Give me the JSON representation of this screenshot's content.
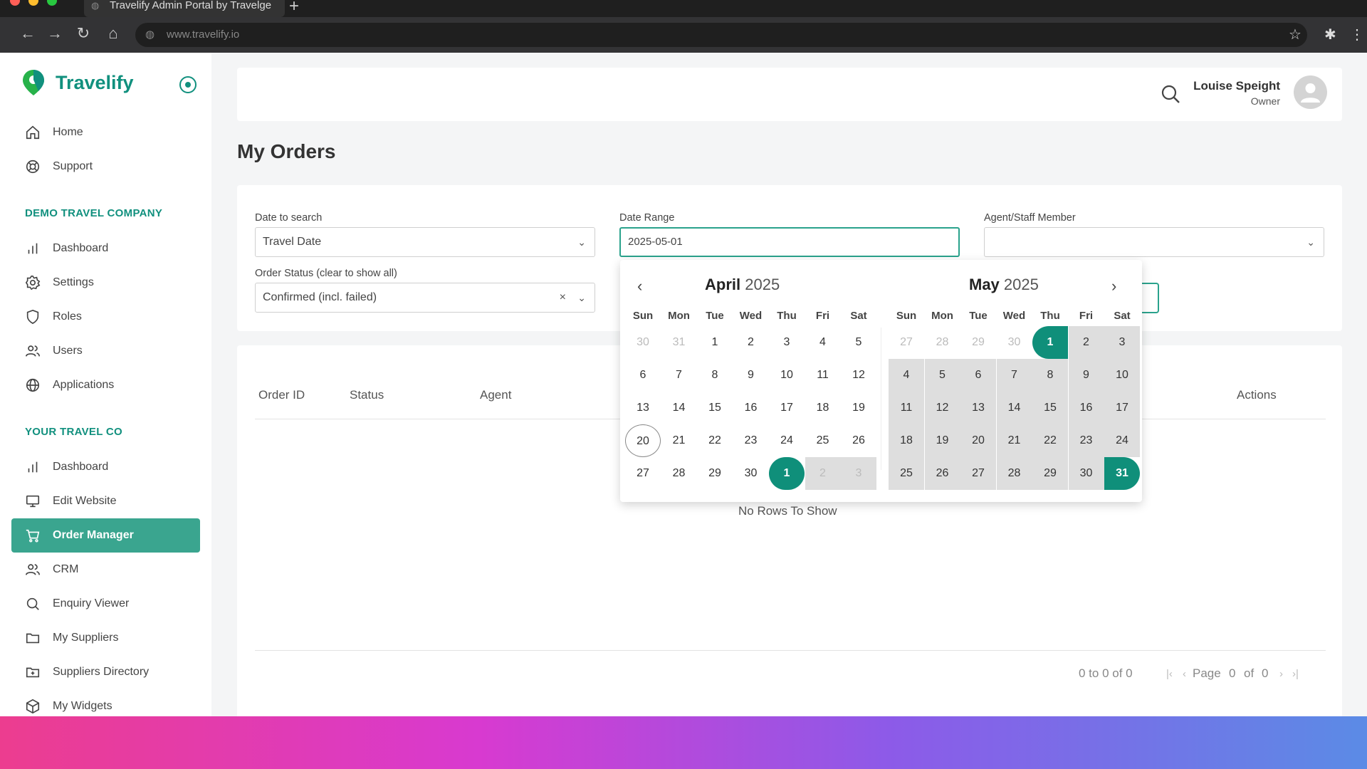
{
  "browser": {
    "tab_title": "Travelify Admin Portal by Travelge",
    "url": "www.travelify.io"
  },
  "sidebar": {
    "brand": "Travelify",
    "top_items": [
      {
        "label": "Home",
        "icon": "home-icon"
      },
      {
        "label": "Support",
        "icon": "lifebuoy-icon"
      }
    ],
    "sections": [
      {
        "title": "DEMO TRAVEL COMPANY",
        "items": [
          {
            "label": "Dashboard",
            "icon": "bar-chart-icon"
          },
          {
            "label": "Settings",
            "icon": "gear-icon"
          },
          {
            "label": "Roles",
            "icon": "shield-icon"
          },
          {
            "label": "Users",
            "icon": "users-icon"
          },
          {
            "label": "Applications",
            "icon": "globe-icon"
          }
        ]
      },
      {
        "title": "YOUR TRAVEL CO",
        "items": [
          {
            "label": "Dashboard",
            "icon": "bar-chart-icon"
          },
          {
            "label": "Edit Website",
            "icon": "monitor-icon"
          },
          {
            "label": "Order Manager",
            "icon": "cart-icon",
            "active": true
          },
          {
            "label": "CRM",
            "icon": "users-icon"
          },
          {
            "label": "Enquiry Viewer",
            "icon": "search-icon"
          },
          {
            "label": "My Suppliers",
            "icon": "folder-icon"
          },
          {
            "label": "Suppliers Directory",
            "icon": "folder-plus-icon"
          },
          {
            "label": "My Widgets",
            "icon": "cube-icon"
          }
        ]
      }
    ]
  },
  "header": {
    "user_name": "Louise Speight",
    "user_role": "Owner"
  },
  "page": {
    "title": "My Orders"
  },
  "filters": {
    "date_to_search_label": "Date to search",
    "date_to_search_value": "Travel Date",
    "date_range_label": "Date Range",
    "date_range_value": "2025-05-01",
    "agent_label": "Agent/Staff Member",
    "agent_value": "",
    "order_status_label": "Order Status (clear to show all)",
    "order_status_value": "Confirmed (incl. failed)"
  },
  "calendar": {
    "left_month": "April",
    "left_year": "2025",
    "right_month": "May",
    "right_year": "2025",
    "weekdays": [
      "Sun",
      "Mon",
      "Tue",
      "Wed",
      "Thu",
      "Fri",
      "Sat"
    ],
    "left_days": [
      [
        "30",
        "31",
        "1",
        "2",
        "3",
        "4",
        "5"
      ],
      [
        "6",
        "7",
        "8",
        "9",
        "10",
        "11",
        "12"
      ],
      [
        "13",
        "14",
        "15",
        "16",
        "17",
        "18",
        "19"
      ],
      [
        "20",
        "21",
        "22",
        "23",
        "24",
        "25",
        "26"
      ],
      [
        "27",
        "28",
        "29",
        "30",
        "1",
        "2",
        "3"
      ]
    ],
    "right_days": [
      [
        "27",
        "28",
        "29",
        "30",
        "1",
        "2",
        "3"
      ],
      [
        "4",
        "5",
        "6",
        "7",
        "8",
        "9",
        "10"
      ],
      [
        "11",
        "12",
        "13",
        "14",
        "15",
        "16",
        "17"
      ],
      [
        "18",
        "19",
        "20",
        "21",
        "22",
        "23",
        "24"
      ],
      [
        "25",
        "26",
        "27",
        "28",
        "29",
        "30",
        "31"
      ]
    ]
  },
  "table": {
    "columns": [
      "Order ID",
      "Status",
      "Agent",
      "Actions"
    ],
    "empty_text": "No Rows To Show",
    "range_text": "0 to 0 of 0",
    "page_label": "Page",
    "page_current": "0",
    "page_of": "of",
    "page_total": "0"
  },
  "colors": {
    "brand": "#11907e",
    "accent": "#0f8f7a",
    "active_nav": "#3aa58f"
  }
}
